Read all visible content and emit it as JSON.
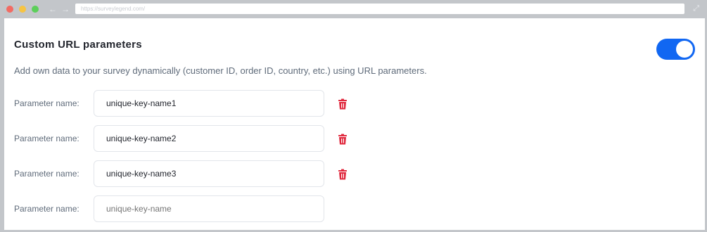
{
  "browser": {
    "url": "https://surveylegend.com/",
    "nav_back": "←",
    "nav_forward": "→",
    "expand_glyph": "⤢"
  },
  "section": {
    "title": "Custom URL parameters",
    "description": "Add own data to your survey dynamically (customer ID, order ID, country, etc.) using URL parameters.",
    "toggle_on": true
  },
  "parameters": [
    {
      "label": "Parameter name:",
      "value": "unique-key-name1",
      "deletable": true
    },
    {
      "label": "Parameter name:",
      "value": "unique-key-name2",
      "deletable": true
    },
    {
      "label": "Parameter name:",
      "value": "unique-key-name3",
      "deletable": true
    },
    {
      "label": "Parameter name:",
      "value": "",
      "placeholder": "unique-key-name",
      "deletable": false
    }
  ],
  "colors": {
    "accent": "#1167f2",
    "delete": "#e0283d",
    "text_primary": "#22252d",
    "text_secondary": "#5f6b7a"
  }
}
